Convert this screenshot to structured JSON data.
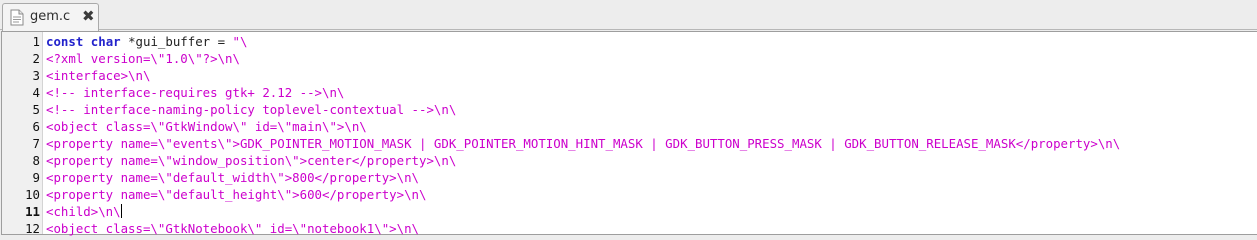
{
  "tab": {
    "title": "gem.c",
    "file_icon": "text-file-icon",
    "close_icon": "close-icon",
    "close_glyph": "✖"
  },
  "editor": {
    "current_line": 11,
    "line1": {
      "number": "1",
      "kw1": "const",
      "kw2": "char",
      "rest": " *gui_buffer = ",
      "str": "\"\\"
    },
    "lines": [
      {
        "number": "2",
        "text": "<?xml version=\\\"1.0\\\"?>\\n\\"
      },
      {
        "number": "3",
        "text": "<interface>\\n\\"
      },
      {
        "number": "4",
        "text": "<!-- interface-requires gtk+ 2.12 -->\\n\\"
      },
      {
        "number": "5",
        "text": "<!-- interface-naming-policy toplevel-contextual -->\\n\\"
      },
      {
        "number": "6",
        "text": "<object class=\\\"GtkWindow\\\" id=\\\"main\\\">\\n\\"
      },
      {
        "number": "7",
        "text": "<property name=\\\"events\\\">GDK_POINTER_MOTION_MASK | GDK_POINTER_MOTION_HINT_MASK | GDK_BUTTON_PRESS_MASK | GDK_BUTTON_RELEASE_MASK</property>\\n\\"
      },
      {
        "number": "8",
        "text": "<property name=\\\"window_position\\\">center</property>\\n\\"
      },
      {
        "number": "9",
        "text": "<property name=\\\"default_width\\\">800</property>\\n\\"
      },
      {
        "number": "10",
        "text": "<property name=\\\"default_height\\\">600</property>\\n\\"
      },
      {
        "number": "11",
        "text": "<child>\\n\\"
      },
      {
        "number": "12",
        "text": "<object class=\\\"GtkNotebook\\\" id=\\\"notebook1\\\">\\n\\"
      }
    ]
  },
  "colors": {
    "keyword": "#2222cc",
    "string": "#cc00cc",
    "gutter_bg": "#f0f0f0",
    "editor_bg": "#ffffff"
  }
}
